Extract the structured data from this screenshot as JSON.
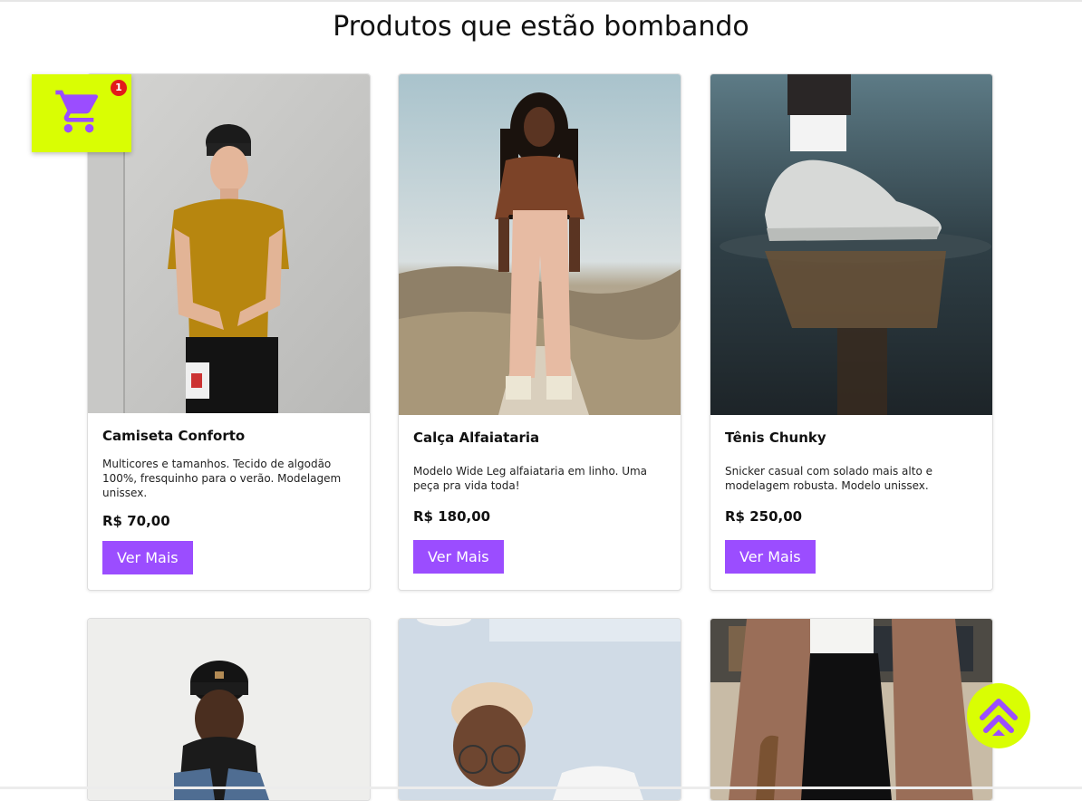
{
  "section": {
    "title": "Produtos que estão bombando"
  },
  "cart": {
    "icon": "shopping-cart-icon",
    "count": "1",
    "background": "#d9fe03",
    "badge_color": "#e21b1b",
    "icon_color": "#9b4dff"
  },
  "back_to_top": {
    "icon": "double-chevron-up-icon",
    "background": "#d9fe03",
    "icon_color": "#9b4dff"
  },
  "accent_color": "#9b4dff",
  "products": [
    {
      "name": "Camiseta Conforto",
      "description": "Multicores e tamanhos. Tecido de algodão 100%, fresquinho para o verão. Modelagem unissex.",
      "price": "R$ 70,00",
      "button": "Ver Mais"
    },
    {
      "name": "Calça Alfaiataria",
      "description": "Modelo Wide Leg alfaiataria em linho. Uma peça pra vida toda!",
      "price": "R$ 180,00",
      "button": "Ver Mais"
    },
    {
      "name": "Tênis Chunky",
      "description": "Snicker casual com solado mais alto e modelagem robusta. Modelo unissex.",
      "price": "R$ 250,00",
      "button": "Ver Mais"
    }
  ]
}
